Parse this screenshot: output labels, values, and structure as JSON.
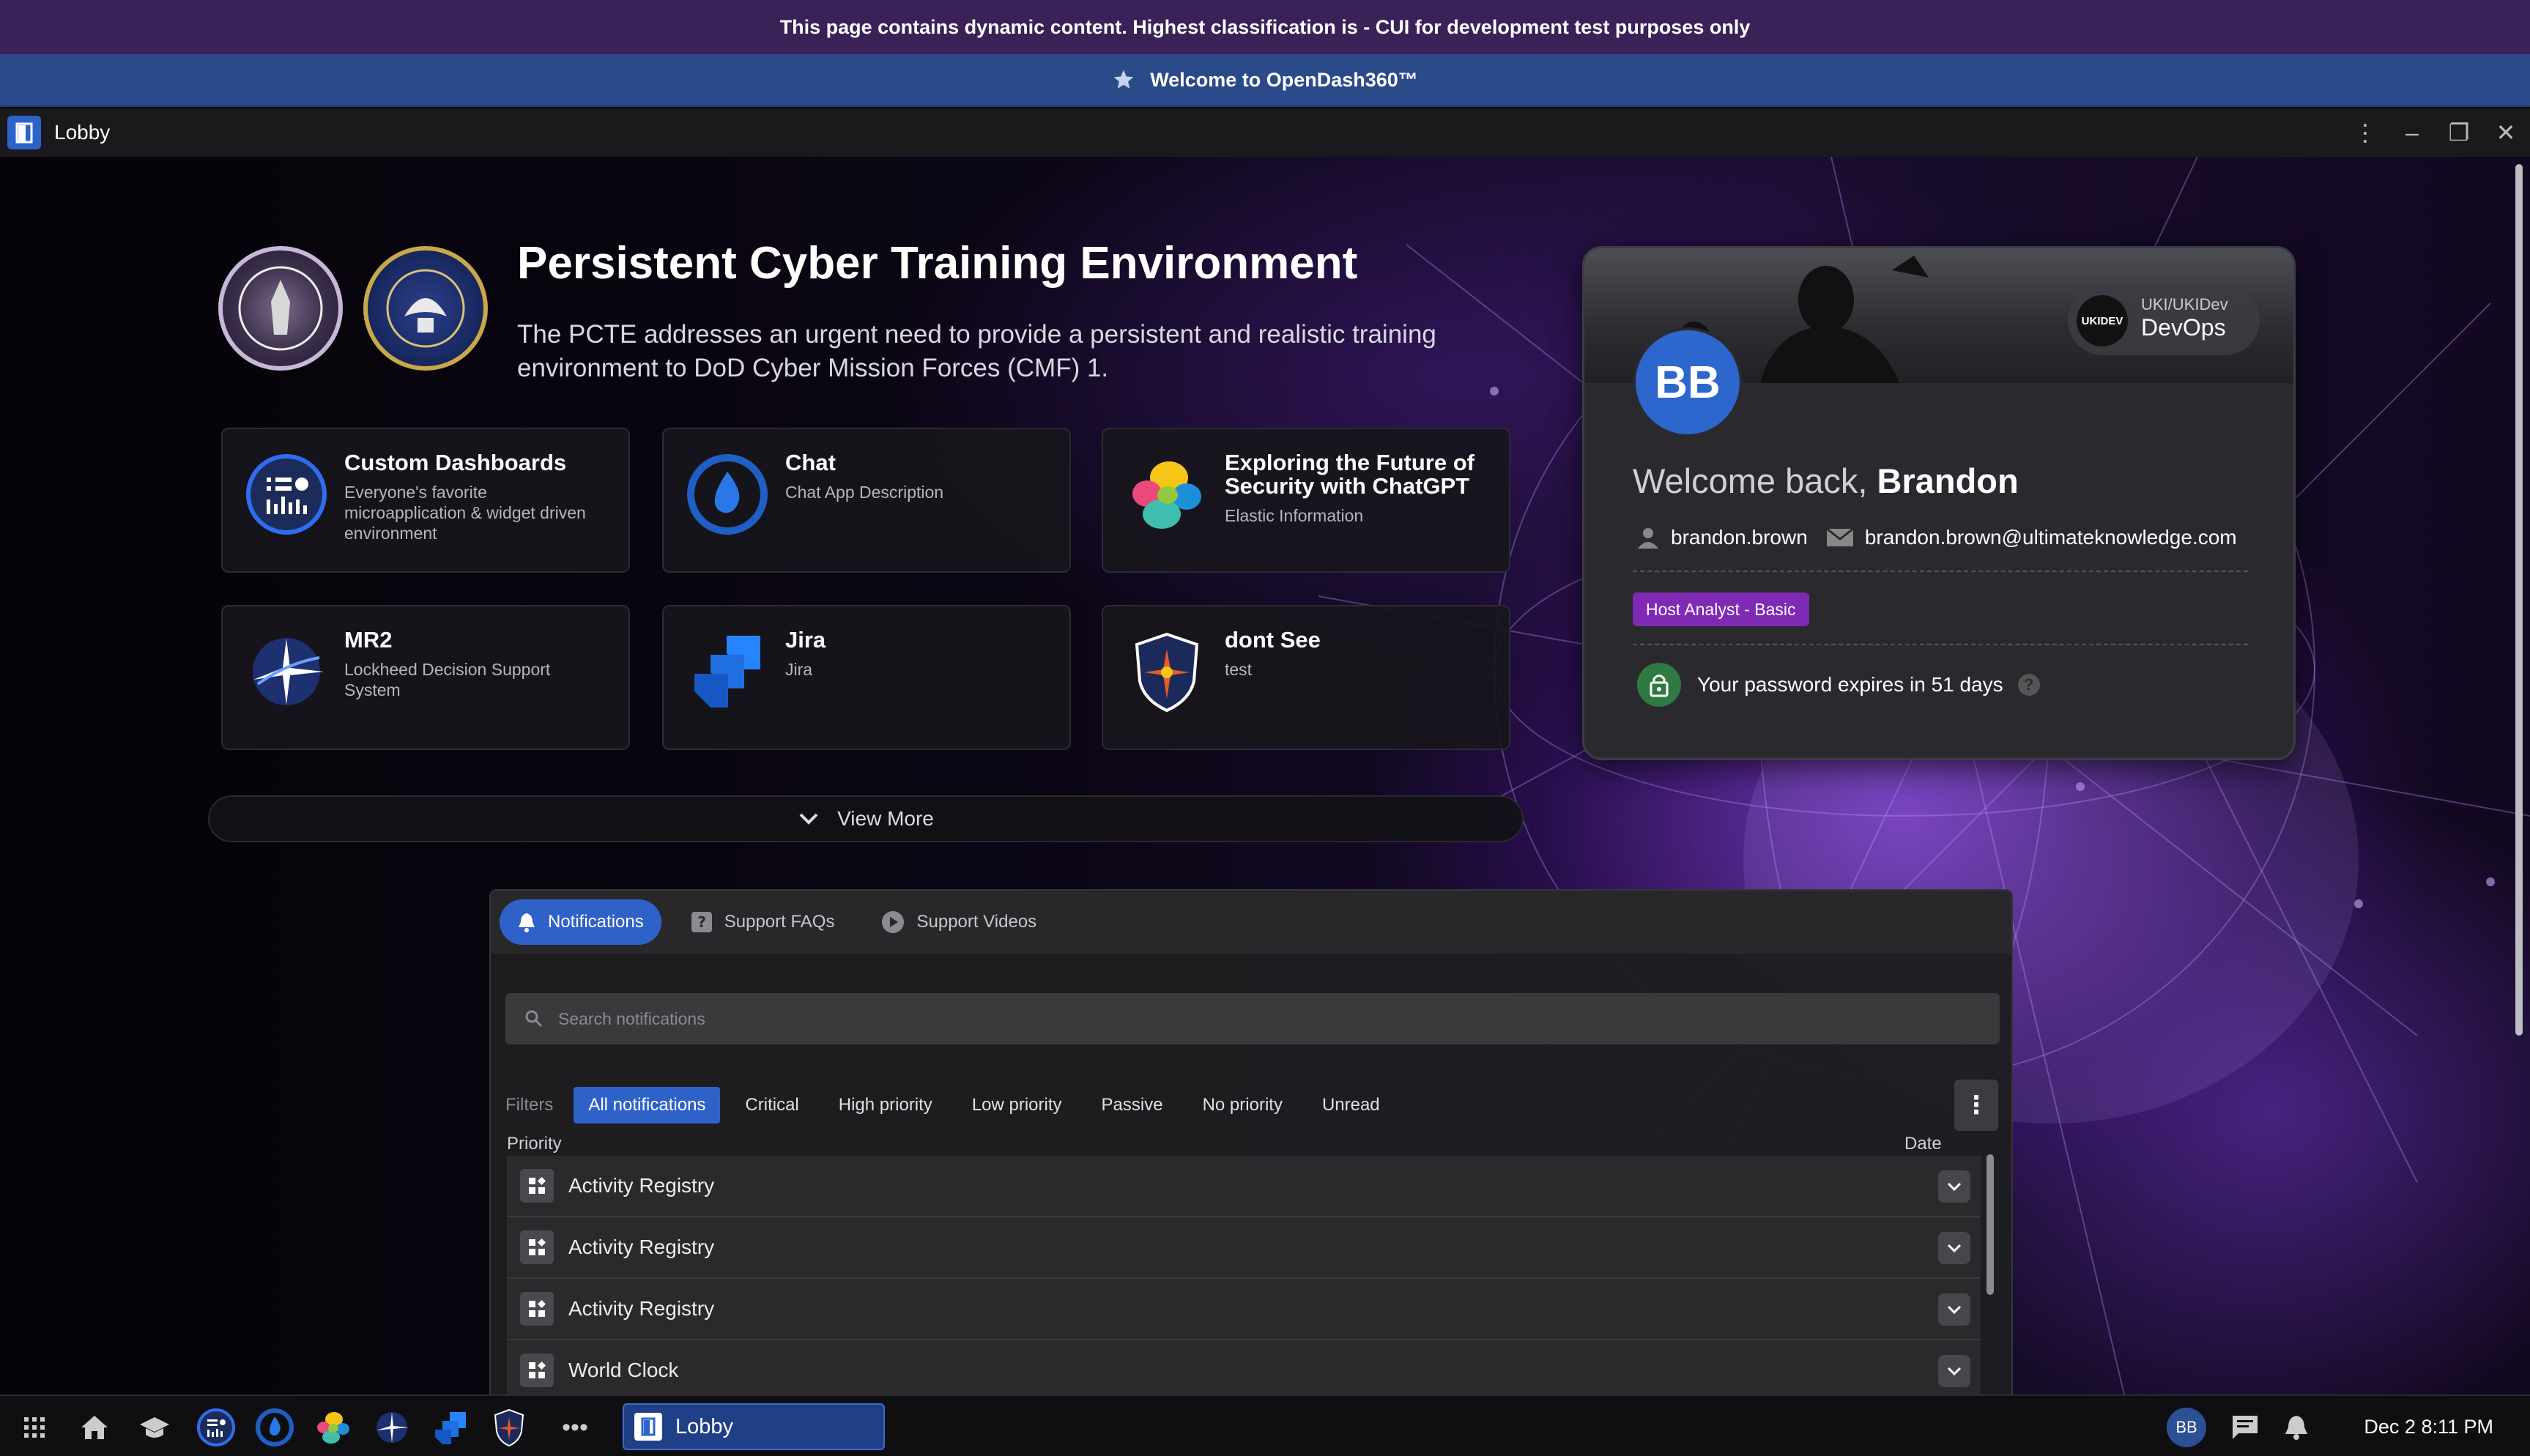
{
  "banner": {
    "cui_text": "This page contains dynamic content. Highest classification is - CUI for development test purposes only",
    "welcome_text": "Welcome to OpenDash360™"
  },
  "window": {
    "title": "Lobby",
    "controls": [
      "more-icon",
      "minimize-icon",
      "maximize-icon",
      "close-icon"
    ]
  },
  "hero": {
    "title": "Persistent Cyber Training Environment",
    "description": "The PCTE addresses an urgent need to provide a persistent and realistic training environment to DoD Cyber Mission Forces (CMF) 1."
  },
  "tiles": [
    {
      "title": "Custom Dashboards",
      "description": "Everyone's favorite microapplication & widget driven environment",
      "icon": "dashboard-icon"
    },
    {
      "title": "Chat",
      "description": "Chat App Description",
      "icon": "chat-drop-icon"
    },
    {
      "title": "Exploring the Future of Security with ChatGPT",
      "description": "Elastic Information",
      "icon": "elastic-icon"
    },
    {
      "title": "MR2",
      "description": "Lockheed Decision Support System",
      "icon": "lockheed-star-icon"
    },
    {
      "title": "Jira",
      "description": "Jira",
      "icon": "jira-icon"
    },
    {
      "title": "dont See",
      "description": "test",
      "icon": "shield-crest-icon"
    }
  ],
  "view_more": "View More",
  "profile": {
    "initials": "BB",
    "org_sub": "UKI/UKIDev",
    "org_name": "DevOps",
    "org_logo_text": "UKIDEV",
    "welcome_prefix": "Welcome back, ",
    "first_name": "Brandon",
    "username": "brandon.brown",
    "email": "brandon.brown@ultimateknowledge.com",
    "role": "Host Analyst - Basic",
    "password_notice": "Your password expires in 51 days"
  },
  "notifications": {
    "tabs": [
      {
        "label": "Notifications",
        "icon": "bell-icon",
        "active": true
      },
      {
        "label": "Support FAQs",
        "icon": "faq-icon",
        "active": false
      },
      {
        "label": "Support Videos",
        "icon": "play-icon",
        "active": false
      }
    ],
    "search_placeholder": "Search notifications",
    "filters_label": "Filters",
    "filters": [
      "All notifications",
      "Critical",
      "High priority",
      "Low priority",
      "Passive",
      "No priority",
      "Unread"
    ],
    "active_filter": "All notifications",
    "columns": {
      "priority": "Priority",
      "date": "Date"
    },
    "rows": [
      "Activity Registry",
      "Activity Registry",
      "Activity Registry",
      "World Clock"
    ]
  },
  "taskbar": {
    "task_label": "Lobby",
    "user_initials": "BB",
    "clock": "Dec 2 8:11 PM"
  },
  "colors": {
    "accent": "#2e62c9",
    "cui_banner": "#3a2158",
    "welcome_banner": "#2b4a8a",
    "role_badge": "#7e2ab5",
    "lock_ok": "#2f7a42"
  }
}
